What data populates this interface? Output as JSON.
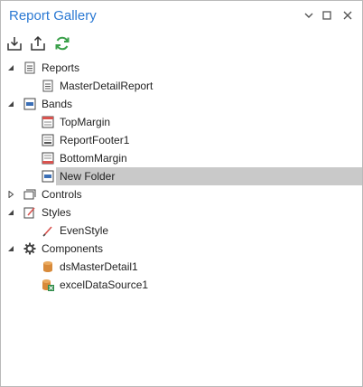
{
  "window": {
    "title": "Report Gallery",
    "buttons": {
      "pin_icon": "chevron-down-icon",
      "maximize_icon": "maximize-icon",
      "close_icon": "close-icon"
    }
  },
  "toolbar": {
    "items": [
      {
        "icon": "import-icon"
      },
      {
        "icon": "export-icon"
      },
      {
        "icon": "refresh-icon"
      }
    ]
  },
  "tree": {
    "reports": {
      "label": "Reports",
      "expanded": true,
      "children": [
        {
          "label": "MasterDetailReport"
        }
      ]
    },
    "bands": {
      "label": "Bands",
      "expanded": true,
      "children": [
        {
          "label": "TopMargin"
        },
        {
          "label": "ReportFooter1"
        },
        {
          "label": "BottomMargin"
        },
        {
          "label": "New Folder",
          "selected": true
        }
      ]
    },
    "controls": {
      "label": "Controls",
      "expanded": false
    },
    "styles": {
      "label": "Styles",
      "expanded": true,
      "children": [
        {
          "label": "EvenStyle"
        }
      ]
    },
    "components": {
      "label": "Components",
      "expanded": true,
      "children": [
        {
          "label": "dsMasterDetail1"
        },
        {
          "label": "excelDataSource1"
        }
      ]
    }
  },
  "colors": {
    "title": "#2b79d3",
    "selection": "#c9c9c9",
    "refresh": "#3aa04a",
    "database": "#d88a3a"
  }
}
